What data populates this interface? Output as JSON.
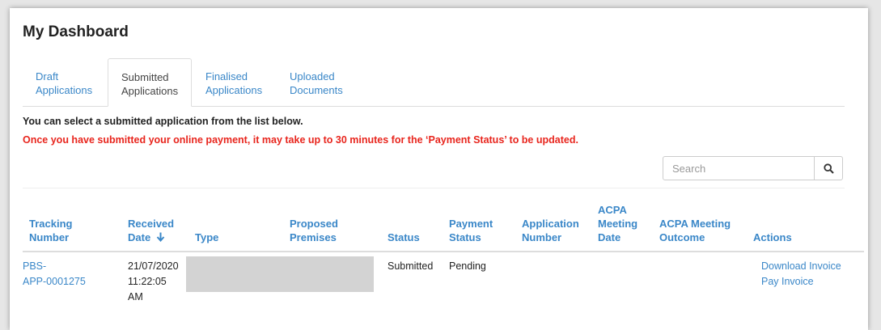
{
  "page": {
    "title": "My Dashboard"
  },
  "tabs": [
    {
      "line1": "Draft",
      "line2": "Applications"
    },
    {
      "line1": "Submitted",
      "line2": "Applications"
    },
    {
      "line1": "Finalised",
      "line2": "Applications"
    },
    {
      "line1": "Uploaded",
      "line2": "Documents"
    }
  ],
  "active_tab": 1,
  "messages": {
    "info": "You can select a submitted application from the list below.",
    "warning": "Once you have submitted your online payment, it may take up to 30 minutes for the ‘Payment Status’ to be updated."
  },
  "search": {
    "placeholder": "Search",
    "icon": "search-icon"
  },
  "table": {
    "headers": {
      "tracking": [
        "Tracking",
        "Number"
      ],
      "received": [
        "Received",
        "Date"
      ],
      "type": [
        "Type"
      ],
      "premises": [
        "Proposed",
        "Premises"
      ],
      "status": [
        "Status"
      ],
      "payment": [
        "Payment",
        "Status"
      ],
      "appnum": [
        "Application",
        "Number"
      ],
      "meeting_date": [
        "ACPA",
        "Meeting",
        "Date"
      ],
      "outcome": [
        "ACPA Meeting",
        "Outcome"
      ],
      "actions": [
        "Actions"
      ]
    },
    "sort_icon": "arrow-down-icon",
    "rows": [
      {
        "tracking": [
          "PBS-",
          "APP-0001275"
        ],
        "received": [
          "21/07/2020",
          "11:22:05",
          "AM"
        ],
        "status": "Submitted",
        "payment": "Pending",
        "actions": [
          "Download Invoice",
          "Pay Invoice"
        ]
      }
    ]
  },
  "colors": {
    "link": "#3a87c8",
    "warning": "#e8251d",
    "redacted": "#d3d3d3"
  }
}
